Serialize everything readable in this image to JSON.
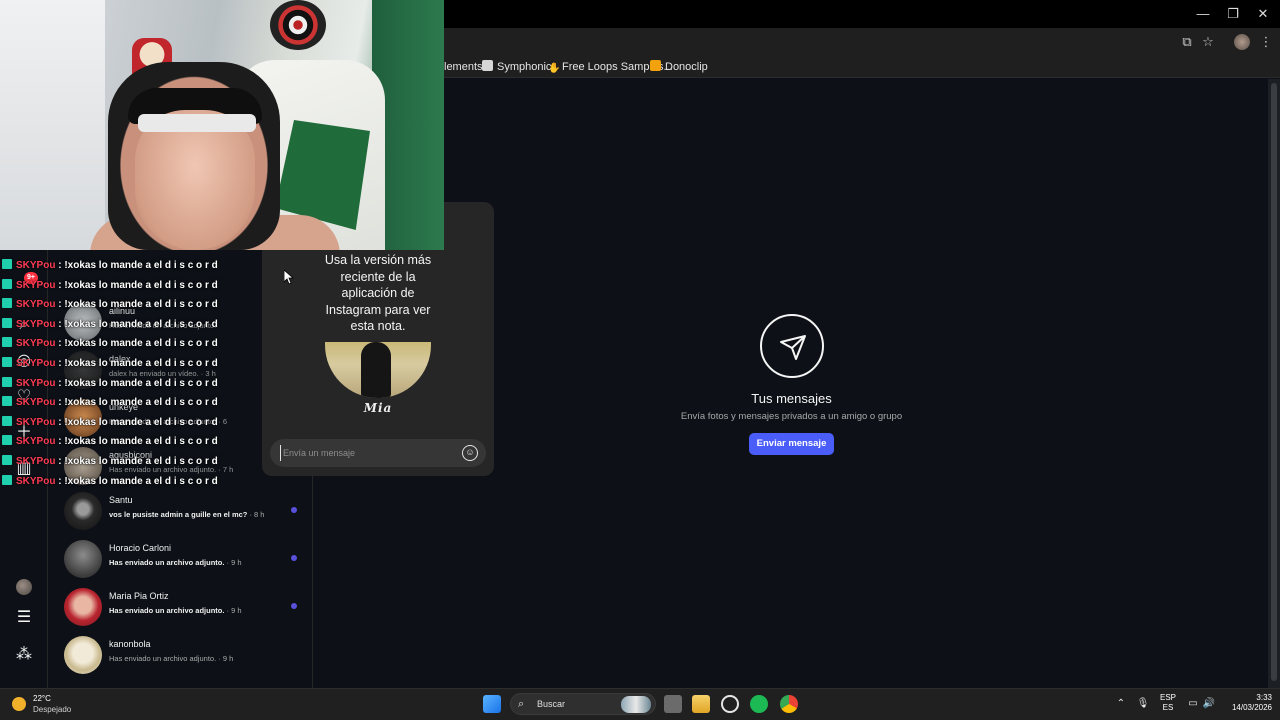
{
  "window": {
    "minimize": "—",
    "restore": "❐",
    "close": "✕"
  },
  "bookmarks": [
    {
      "label": "lements",
      "icon": "document-icon",
      "color": "#8ab4f8"
    },
    {
      "label": "Symphonic",
      "icon": "symphonic-icon",
      "color": "#d7d7d7"
    },
    {
      "label": "Free Loops Samples...",
      "icon": "hand-icon",
      "color": "#d7d7d7"
    },
    {
      "label": "Donoclip",
      "icon": "donoclip-icon",
      "color": "#f2a20d"
    }
  ],
  "note": {
    "text_lines": [
      "Usa la versión más",
      "reciente de la",
      "aplicación de",
      "Instagram para ver",
      "esta nota."
    ],
    "author": "Mia",
    "input_placeholder": "Envía un mensaje"
  },
  "conversations": [
    {
      "name": "Santu",
      "preview": "vos le pusiste admin a guille en el mc?",
      "time": " · 8 h",
      "unread": true
    },
    {
      "name": "Horacio Carloni",
      "preview": "Has enviado un archivo adjunto.",
      "time": " · 9 h",
      "unread": true
    },
    {
      "name": "Maria Pia Ortiz",
      "preview": "Has enviado un archivo adjunto.",
      "time": " · 9 h",
      "unread": true
    },
    {
      "name": "kanonbola",
      "preview": "Has enviado un archivo adjunto.",
      "time": " · 9 h",
      "unread": false
    }
  ],
  "background_conversations": [
    {
      "name": "ailinuu",
      "preview": "Has enviado un archivo adjunto."
    },
    {
      "name": "dalex",
      "preview": "dalex ha enviado un vídeo. · 3 h"
    },
    {
      "name": "unkeye",
      "preview": "Has enviado un archivo adjunto. · 6"
    },
    {
      "name": "agusbjconi",
      "preview": "Has enviado un archivo adjunto. · 7 h"
    }
  ],
  "chat": {
    "user": "SKYPou",
    "message": " : !xokas lo mande a el d i s c o r d",
    "count": 12
  },
  "empty_state": {
    "title": "Tus mensajes",
    "subtitle": "Envía fotos y mensajes privados a un amigo o grupo",
    "button": "Enviar mensaje"
  },
  "rail": {
    "notification_badge": "9+"
  },
  "taskbar": {
    "temperature": "22°C",
    "weather": "Despejado",
    "search_label": "Buscar",
    "language": "ESP",
    "region": "ES",
    "time": "3:33",
    "date": "14/03/2026"
  },
  "colors": {
    "accent": "#4a5df9",
    "unread_dot": "#5851db",
    "chat_user": "#ff3b54"
  }
}
